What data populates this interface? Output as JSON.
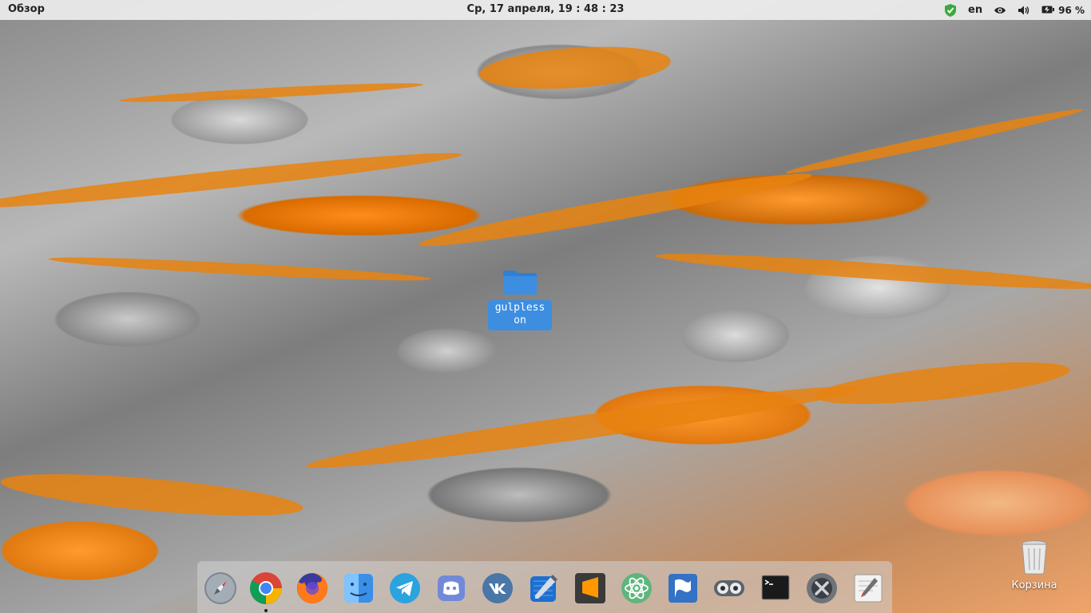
{
  "topbar": {
    "overview_label": "Обзор",
    "clock": "Ср, 17 апреля, 19 : 48 : 23",
    "keyboard_layout": "en",
    "battery_percent": "96 %"
  },
  "desktop": {
    "folder": {
      "name": "gulpless\non"
    },
    "trash": {
      "label": "Корзина"
    }
  },
  "dock": {
    "apps": [
      {
        "icon": "launcher-rocket-icon",
        "running": false
      },
      {
        "icon": "chrome-icon",
        "running": true
      },
      {
        "icon": "firefox-icon",
        "running": false
      },
      {
        "icon": "finder-files-icon",
        "running": false
      },
      {
        "icon": "telegram-icon",
        "running": false
      },
      {
        "icon": "discord-icon",
        "running": false
      },
      {
        "icon": "vk-icon",
        "running": false
      },
      {
        "icon": "xcode-icon",
        "running": false
      },
      {
        "icon": "sublime-text-icon",
        "running": false
      },
      {
        "icon": "atom-icon",
        "running": false
      },
      {
        "icon": "typora-icon",
        "running": false
      },
      {
        "icon": "vpn-mask-icon",
        "running": false
      },
      {
        "icon": "terminal-icon",
        "running": false
      },
      {
        "icon": "system-settings-icon",
        "running": false
      },
      {
        "icon": "text-editor-icon",
        "running": false
      }
    ]
  },
  "colors": {
    "accent_blue": "#3d8ee0",
    "wallpaper_orange": "#e8830f",
    "shield_green": "#3aaa3a"
  }
}
